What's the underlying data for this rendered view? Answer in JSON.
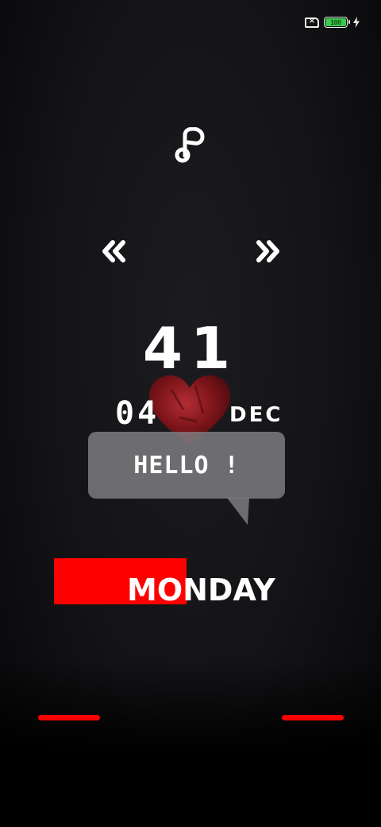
{
  "status_bar": {
    "sim_icon": "no-sim-icon",
    "sim_glyph": "×",
    "battery_level": "100",
    "battery_color": "#3cc94b",
    "charging_icon": "lightning-bolt-icon"
  },
  "music": {
    "icon": "music-note-icon",
    "prev_icon": "double-chevron-left-icon",
    "next_icon": "double-chevron-right-icon"
  },
  "clock": {
    "number": "41",
    "day": "04",
    "month": "DEC",
    "weekday": "MONDAY",
    "heart_icon": "heart-icon"
  },
  "bubble": {
    "text": "HELLO !"
  },
  "colors": {
    "accent": "#ff0000",
    "bubble": "#808084",
    "background": "#131316"
  }
}
